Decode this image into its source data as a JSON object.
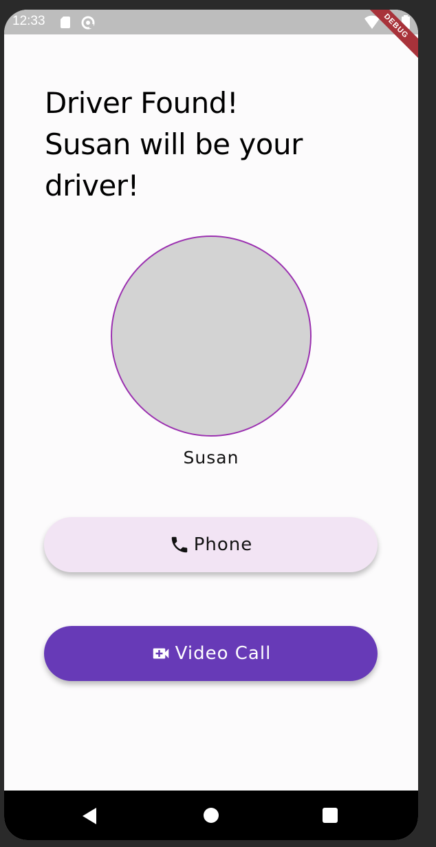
{
  "status_bar": {
    "time": "12:33",
    "debug_label": "DEBUG",
    "icons": [
      "sd-card-icon",
      "sync-icon",
      "wifi-icon",
      "battery-icon"
    ]
  },
  "main": {
    "title": "Driver Found!\nSusan will be your driver!",
    "driver_name": "Susan",
    "avatar_border_color": "#9b30b0",
    "avatar_fill_color": "#d3d3d3"
  },
  "buttons": {
    "phone": {
      "label": "Phone",
      "icon": "phone-icon",
      "background": "#f2e4f4"
    },
    "video": {
      "label": "Video Call",
      "icon": "video-call-icon",
      "background": "#673ab7"
    }
  },
  "nav_bar": {
    "icons": [
      "back-icon",
      "home-icon",
      "recents-icon"
    ]
  }
}
